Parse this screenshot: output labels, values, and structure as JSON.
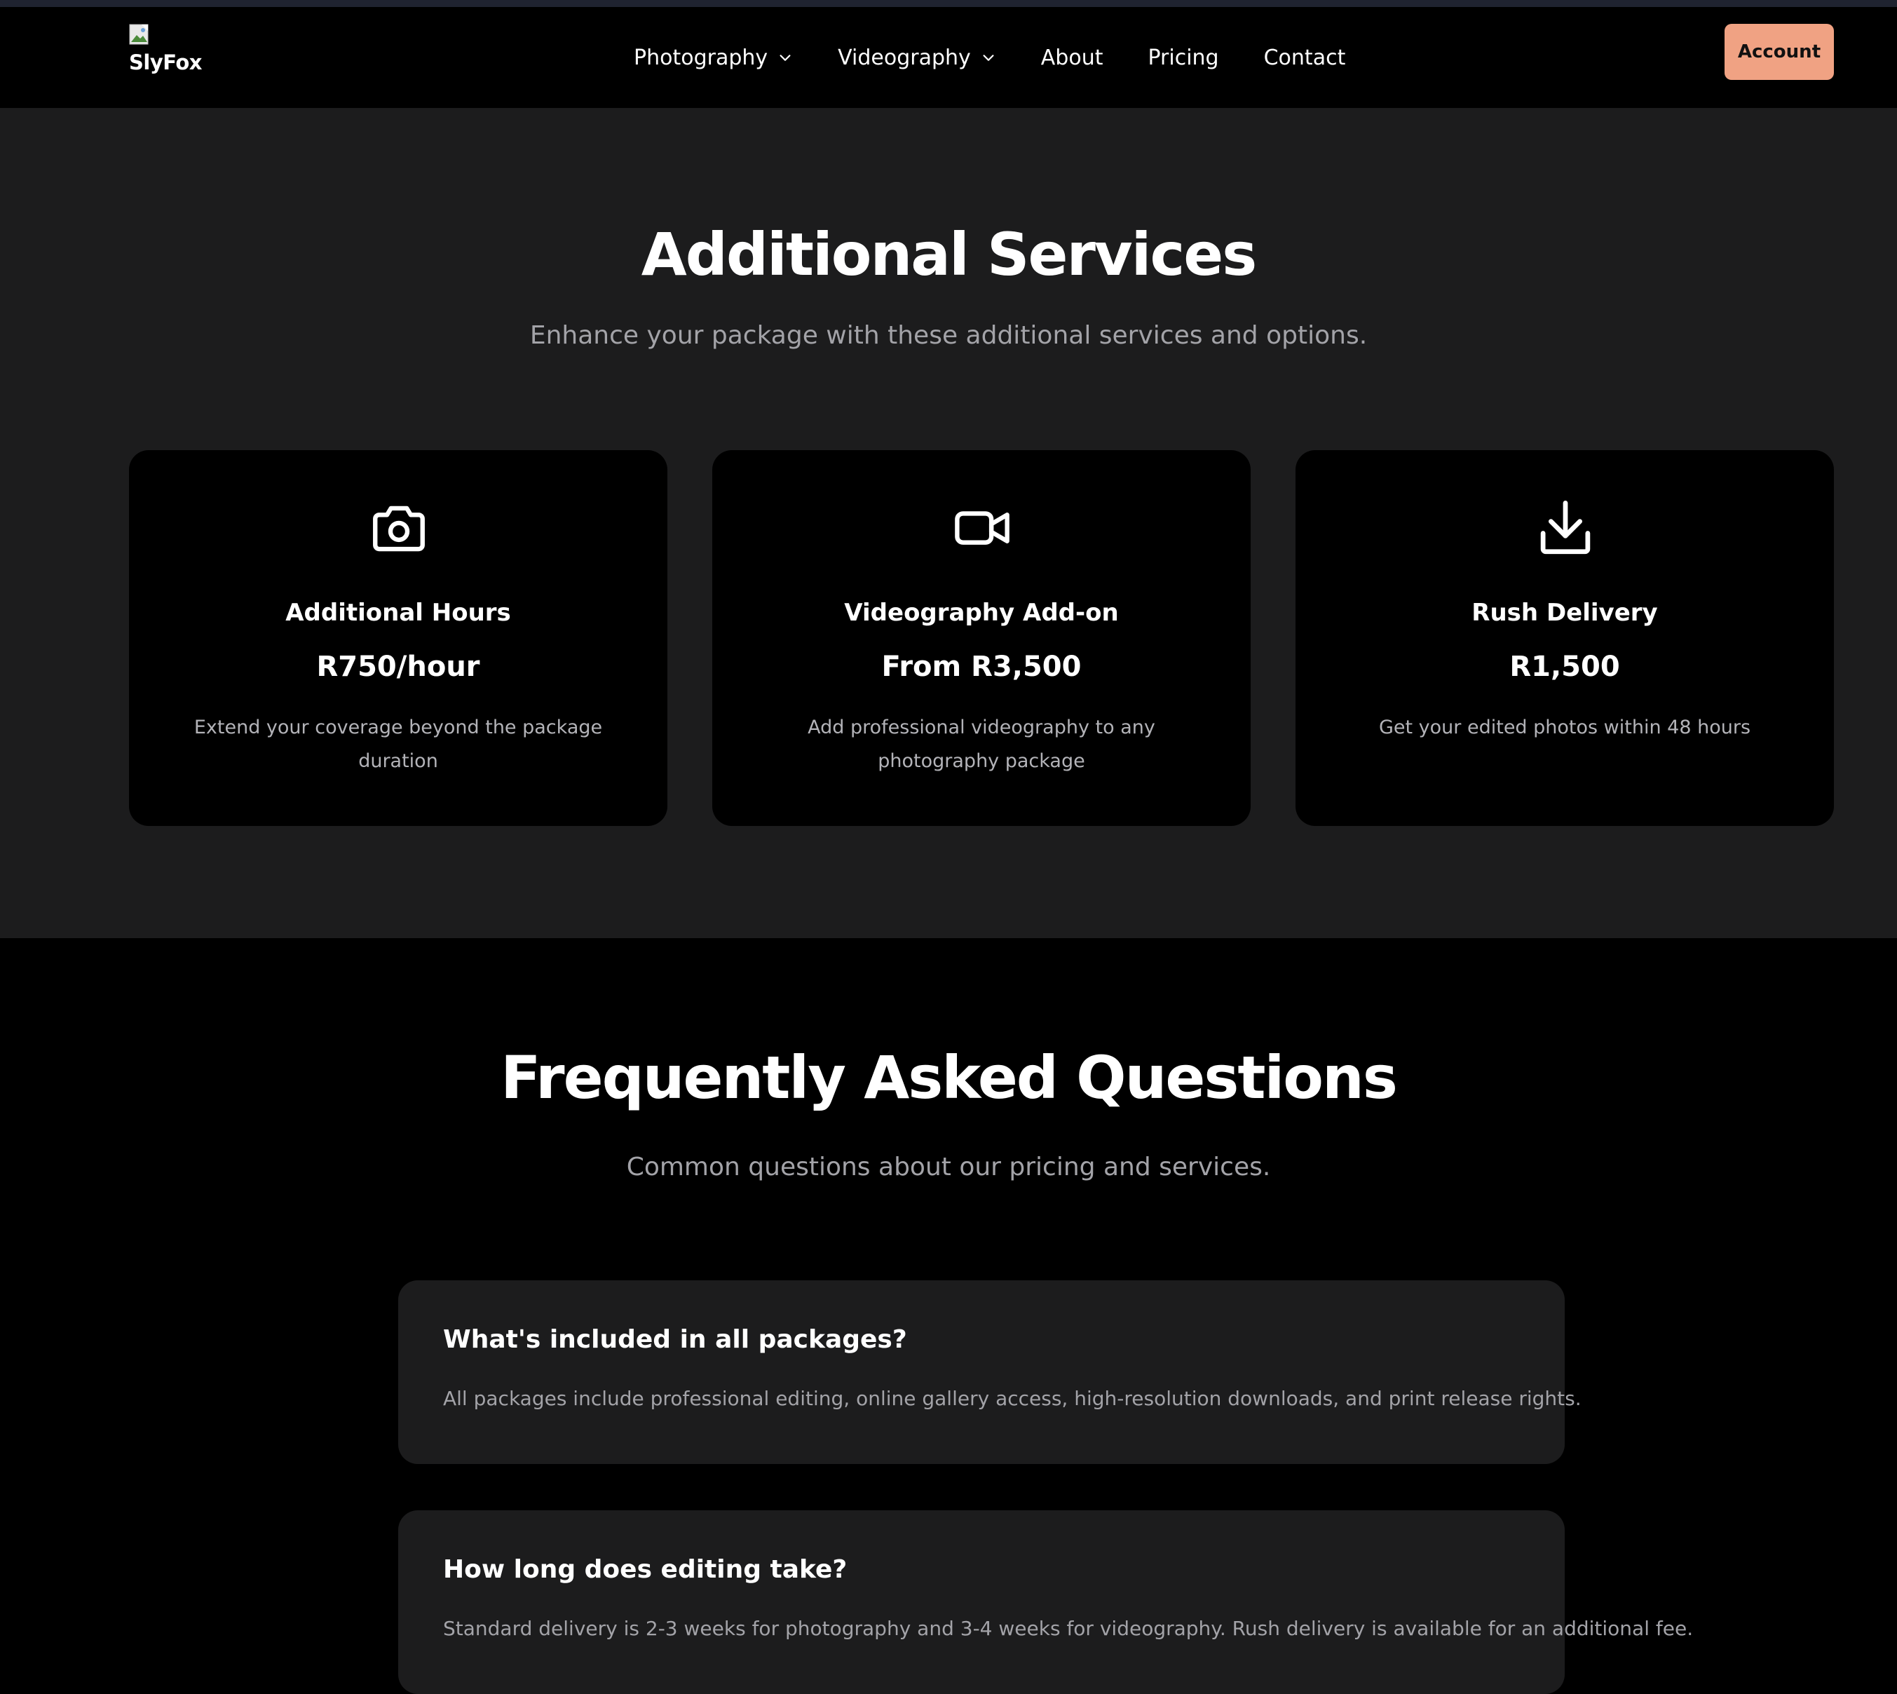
{
  "nav": {
    "brand": "SlyFox",
    "items": [
      {
        "label": "Photography",
        "dropdown": true
      },
      {
        "label": "Videography",
        "dropdown": true
      },
      {
        "label": "About",
        "dropdown": false
      },
      {
        "label": "Pricing",
        "dropdown": false
      },
      {
        "label": "Contact",
        "dropdown": false
      }
    ],
    "account_label": "Account"
  },
  "services": {
    "title": "Additional Services",
    "subtitle": "Enhance your package with these additional services and options.",
    "cards": [
      {
        "icon": "camera-icon",
        "title": "Additional Hours",
        "price": "R750/hour",
        "description": "Extend your coverage beyond the package duration"
      },
      {
        "icon": "video-camera-icon",
        "title": "Videography Add-on",
        "price": "From R3,500",
        "description": "Add professional videography to any photography package"
      },
      {
        "icon": "download-icon",
        "title": "Rush Delivery",
        "price": "R1,500",
        "description": "Get your edited photos within 48 hours"
      }
    ]
  },
  "faq": {
    "title": "Frequently Asked Questions",
    "subtitle": "Common questions about our pricing and services.",
    "items": [
      {
        "question": "What's included in all packages?",
        "answer": "All packages include professional editing, online gallery access, high-resolution downloads, and print release rights."
      },
      {
        "question": "How long does editing take?",
        "answer": "Standard delivery is 2-3 weeks for photography and 3-4 weeks for videography. Rush delivery is available for an additional fee."
      }
    ]
  },
  "colors": {
    "accent": "#f0a283",
    "section_bg": "#1c1c1d",
    "card_bg": "#000000",
    "muted_text": "#a3a3a8"
  }
}
